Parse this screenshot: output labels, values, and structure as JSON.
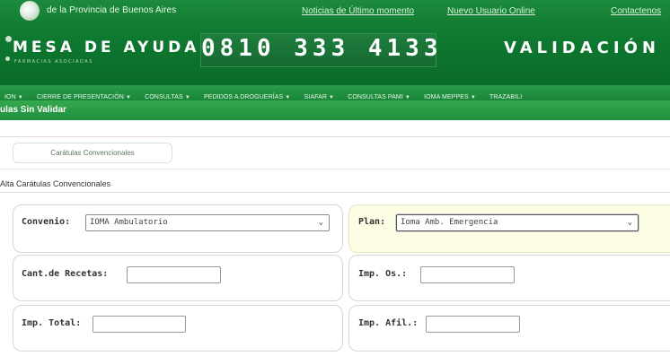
{
  "header": {
    "org_name": "de la Provincia de Buenos Aires",
    "links": [
      "Noticias de Último momento",
      "Nuevo Usuario Online",
      "Contactenos"
    ],
    "brand": "MESA DE AYUDA",
    "brand_sub": "FARMACIAS ASOCIADAS",
    "phone": "0810 333 4133",
    "validation": "VALIDACIÓN O"
  },
  "nav": {
    "items": [
      "ION",
      "CIERRE DE PRESENTACIÓN",
      "CONSULTAS",
      "PEDIDOS A DROGUERÍAS",
      "SIAFAR",
      "CONSULTAS PAMI",
      "IOMA MEPPES",
      "TRAZABILI"
    ]
  },
  "page": {
    "title": "ulas Sin Validar"
  },
  "tabs": {
    "active": "Carátulas Convencionales"
  },
  "section": {
    "title": "Alta Carátulas Convencionales"
  },
  "form": {
    "convenio_label": "Convenio:",
    "convenio_value": "IOMA Ambulatorio",
    "plan_label": "Plan:",
    "plan_value": "Ioma Amb. Emergencia",
    "recetas_label": "Cant.de Recetas:",
    "recetas_value": "",
    "imp_os_label": "Imp. Os.:",
    "imp_os_value": "",
    "imp_total_label": "Imp. Total:",
    "imp_total_value": "",
    "imp_afil_label": "Imp. Afil.:",
    "imp_afil_value": ""
  },
  "colors": {
    "banner_green": "#0f7a31",
    "nav_green": "#1a8638",
    "highlight": "#fdfde6"
  }
}
